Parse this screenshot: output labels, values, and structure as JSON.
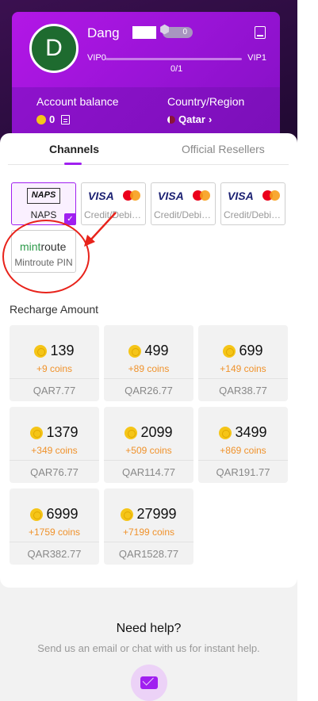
{
  "profile": {
    "avatar_initial": "D",
    "username": "Dang",
    "level_badge": "0",
    "vip_current": "VIP0",
    "vip_next": "VIP1",
    "vip_progress": "0/1"
  },
  "balance": {
    "label": "Account balance",
    "value": "0"
  },
  "region": {
    "label": "Country/Region",
    "value": "Qatar",
    "chevron": "›"
  },
  "tabs": {
    "channels": "Channels",
    "resellers": "Official Resellers"
  },
  "payment_methods": [
    {
      "label": "NAPS",
      "logo": "NAPS",
      "selected": true
    },
    {
      "label": "Credit/Debit Card",
      "logo": "VISA"
    },
    {
      "label": "Credit/Debit Card",
      "logo": "VISA"
    },
    {
      "label": "Credit/Debit Card",
      "logo": "VISA"
    },
    {
      "label": "Mintroute PIN",
      "logo_part1": "mint",
      "logo_part2": "route"
    }
  ],
  "recharge": {
    "title": "Recharge Amount",
    "packages": [
      {
        "coins": "139",
        "bonus": "+9 coins",
        "price": "QAR7.77"
      },
      {
        "coins": "499",
        "bonus": "+89 coins",
        "price": "QAR26.77"
      },
      {
        "coins": "699",
        "bonus": "+149 coins",
        "price": "QAR38.77"
      },
      {
        "coins": "1379",
        "bonus": "+349 coins",
        "price": "QAR76.77"
      },
      {
        "coins": "2099",
        "bonus": "+509 coins",
        "price": "QAR114.77"
      },
      {
        "coins": "3499",
        "bonus": "+869 coins",
        "price": "QAR191.77"
      },
      {
        "coins": "6999",
        "bonus": "+1759 coins",
        "price": "QAR382.77"
      },
      {
        "coins": "27999",
        "bonus": "+7199 coins",
        "price": "QAR1528.77"
      }
    ]
  },
  "help": {
    "title": "Need help?",
    "subtitle": "Send us an email or chat with us for instant help."
  },
  "colors": {
    "accent": "#a020f0",
    "bonus": "#f0922b",
    "annotation": "#e8231b"
  },
  "icons": [
    "phone-icon",
    "document-icon",
    "qatar-flag-icon",
    "coin-icon",
    "check-icon",
    "mail-icon",
    "chevron-right-icon"
  ]
}
